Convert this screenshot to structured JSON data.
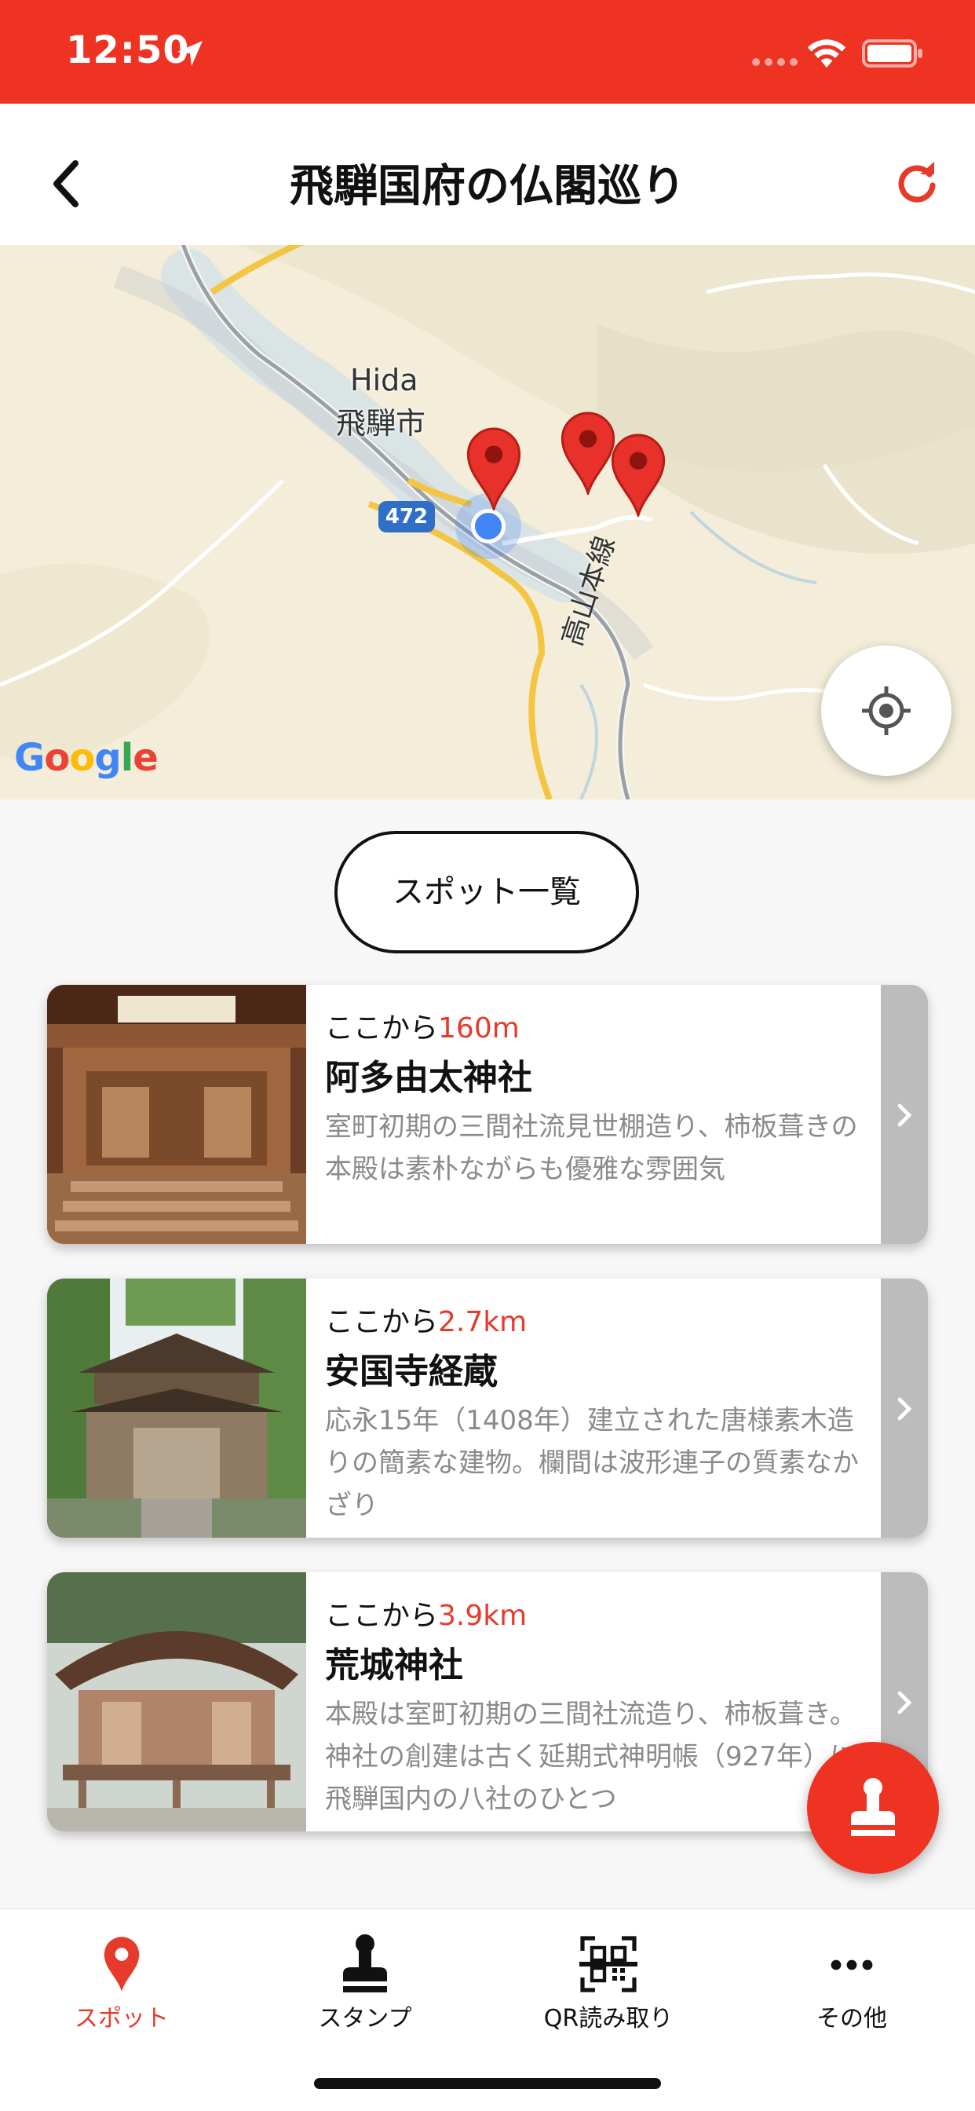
{
  "status_bar": {
    "time": "12:50"
  },
  "header": {
    "title": "飛騨国府の仏閣巡り"
  },
  "map": {
    "labels": {
      "place_en": "Hida",
      "place_jp": "飛騨市",
      "route": "472",
      "rail": "高山本線"
    },
    "logo": "Google"
  },
  "list_button": {
    "label": "スポット一覧"
  },
  "cards": [
    {
      "distance_prefix": "ここから",
      "distance": "160m",
      "name": "阿多由太神社",
      "description": "室町初期の三間社流見世棚造り、柿板葺きの本殿は素朴ながらも優雅な雰囲気"
    },
    {
      "distance_prefix": "ここから",
      "distance": "2.7km",
      "name": "安国寺経蔵",
      "description": "応永15年（1408年）建立された唐様素木造りの簡素な建物。欄間は波形連子の質素なかざり"
    },
    {
      "distance_prefix": "ここから",
      "distance": "3.9km",
      "name": "荒城神社",
      "description": "本殿は室町初期の三間社流造り、柿板葺き。神社の創建は古く延期式神明帳（927年）に飛騨国内の八社のひとつ"
    }
  ],
  "tabs": [
    {
      "label": "スポット",
      "icon": "map-pin-icon",
      "active": true
    },
    {
      "label": "スタンプ",
      "icon": "stamp-icon",
      "active": false
    },
    {
      "label": "QR読み取り",
      "icon": "qr-code-icon",
      "active": false
    },
    {
      "label": "その他",
      "icon": "more-icon",
      "active": false
    }
  ],
  "colors": {
    "accent": "#ee3323",
    "distance": "#e63a2a",
    "pin": "#e8312a",
    "user_location": "#4285f4"
  }
}
